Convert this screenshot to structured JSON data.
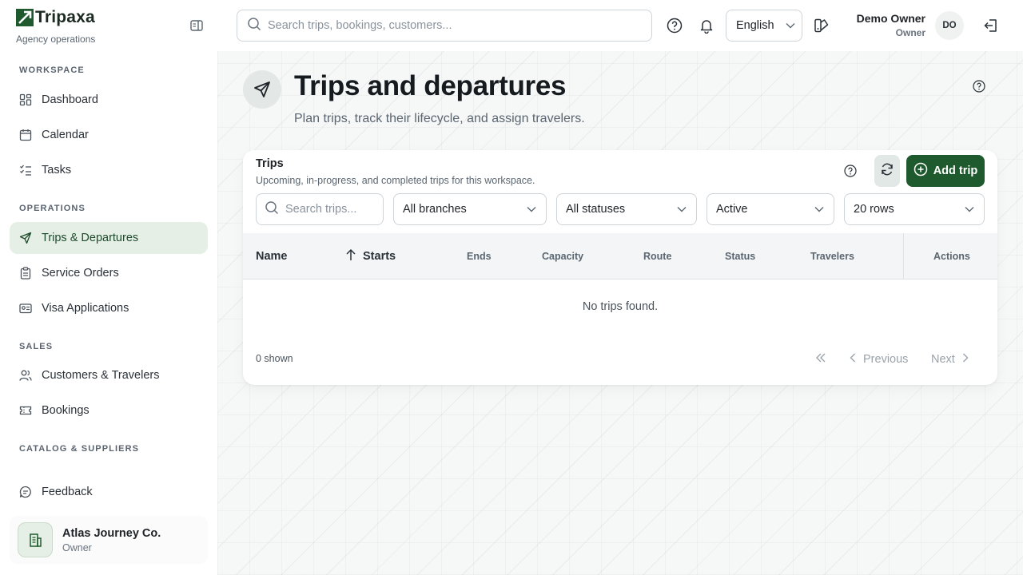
{
  "brand": {
    "name": "Tripaxa",
    "subtitle": "Agency operations"
  },
  "search": {
    "placeholder": "Search trips, bookings, customers..."
  },
  "language": {
    "selected": "English"
  },
  "user": {
    "name": "Demo Owner",
    "role": "Owner",
    "initials": "DO"
  },
  "sidebar": {
    "sections": [
      {
        "label": "WORKSPACE",
        "items": [
          "Dashboard",
          "Calendar",
          "Tasks"
        ]
      },
      {
        "label": "OPERATIONS",
        "items": [
          "Trips & Departures",
          "Service Orders",
          "Visa Applications"
        ]
      },
      {
        "label": "SALES",
        "items": [
          "Customers & Travelers",
          "Bookings"
        ]
      },
      {
        "label": "CATALOG & SUPPLIERS",
        "items": []
      }
    ],
    "feedback": "Feedback",
    "active_item": "Trips & Departures",
    "org": {
      "name": "Atlas Journey Co.",
      "role": "Owner"
    }
  },
  "page": {
    "title": "Trips and departures",
    "subtitle": "Plan trips, track their lifecycle, and assign travelers."
  },
  "card": {
    "title": "Trips",
    "subtitle": "Upcoming, in-progress, and completed trips for this workspace.",
    "add_label": "Add trip",
    "search_placeholder": "Search trips...",
    "filters": {
      "branch": "All branches",
      "status": "All statuses",
      "active": "Active",
      "rows": "20 rows"
    },
    "columns": [
      "Name",
      "Starts",
      "Ends",
      "Capacity",
      "Route",
      "Status",
      "Travelers",
      "Actions"
    ],
    "sort_column": "Starts",
    "empty": "No trips found.",
    "shown": "0 shown",
    "pager": {
      "previous": "Previous",
      "next": "Next"
    }
  },
  "colors": {
    "accent": "#1e5a2e",
    "active_bg": "#e6efe6"
  }
}
